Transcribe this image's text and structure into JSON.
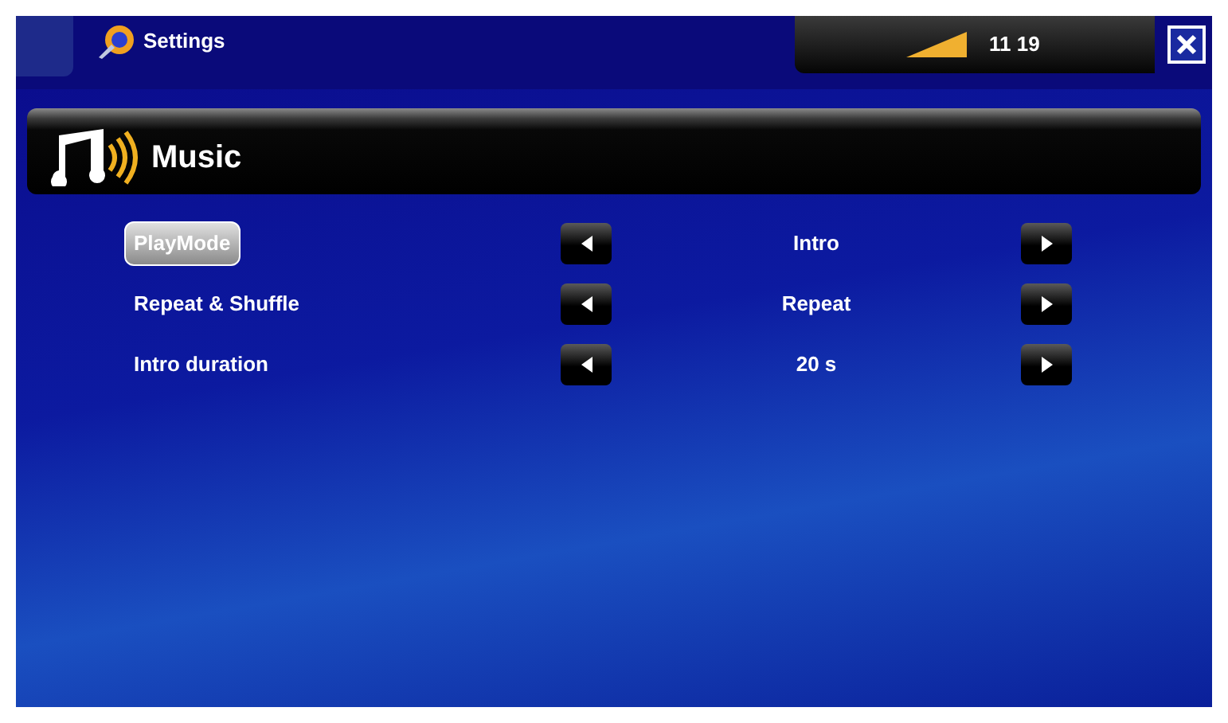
{
  "window": {
    "title": "Settings",
    "time": "11 19"
  },
  "section": {
    "title": "Music"
  },
  "settings": [
    {
      "label": "PlayMode",
      "value": "Intro",
      "selected": true
    },
    {
      "label": "Repeat & Shuffle",
      "value": "Repeat",
      "selected": false
    },
    {
      "label": "Intro duration",
      "value": "20 s",
      "selected": false
    }
  ]
}
